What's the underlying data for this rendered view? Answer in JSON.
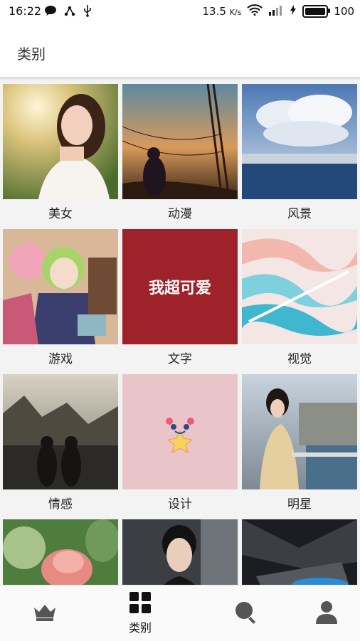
{
  "status_bar": {
    "time": "16:22",
    "speed": "13.5",
    "speed_unit": "K/s",
    "battery": "100"
  },
  "appbar": {
    "title": "类别"
  },
  "categories": [
    {
      "label": "美女",
      "image": "girl-in-sunlight"
    },
    {
      "label": "动漫",
      "image": "anime-sunset-powerlines"
    },
    {
      "label": "风景",
      "image": "sea-and-clouds"
    },
    {
      "label": "游戏",
      "image": "anime-game-characters"
    },
    {
      "label": "文字",
      "image": "red-text-card",
      "image_text": "我超可爱"
    },
    {
      "label": "视觉",
      "image": "marble-swirl"
    },
    {
      "label": "情感",
      "image": "couple-silhouette-lake"
    },
    {
      "label": "设计",
      "image": "pink-face-design"
    },
    {
      "label": "明星",
      "image": "woman-city-balcony"
    },
    {
      "label": "",
      "image": "pink-flower"
    },
    {
      "label": "",
      "image": "man-portrait"
    },
    {
      "label": "",
      "image": "dark-car-abstract"
    }
  ],
  "bottom_nav": {
    "items": [
      {
        "icon": "crown-icon",
        "label": ""
      },
      {
        "icon": "grid-icon",
        "label": "类别"
      },
      {
        "icon": "search-icon",
        "label": ""
      },
      {
        "icon": "user-icon",
        "label": ""
      }
    ]
  },
  "colors": {
    "accent": "#111111",
    "text_card_red": "#9e2229",
    "design_pink": "#e9c4c8"
  }
}
